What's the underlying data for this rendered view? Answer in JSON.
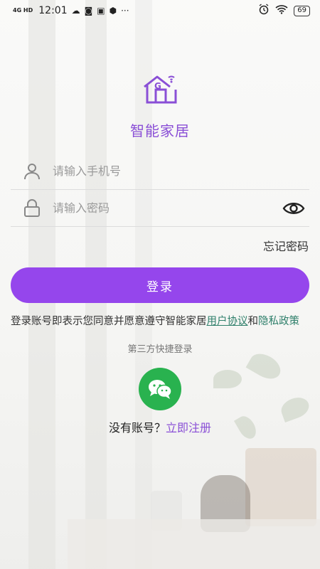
{
  "status_bar": {
    "network": "4G HD",
    "time": "12:01",
    "icons": [
      "cloud-icon",
      "cat-icon",
      "n-icon",
      "shield-icon",
      "more-icon"
    ],
    "right_icons": [
      "alarm-icon",
      "wifi-icon"
    ],
    "battery": "69"
  },
  "app": {
    "logo": "smart-home-logo",
    "title": "智能家居"
  },
  "login": {
    "phone_placeholder": "请输入手机号",
    "password_placeholder": "请输入密码",
    "forgot_password": "忘记密码",
    "login_button": "登录"
  },
  "agreement": {
    "prefix": "登录账号即表示您同意并愿意遵守智能家居",
    "user_agreement": "用户协议",
    "and": "和",
    "privacy_policy": "隐私政策"
  },
  "third_party": {
    "title": "第三方快捷登录",
    "wechat_icon": "wechat-icon"
  },
  "register": {
    "prompt": "没有账号？",
    "link": "立即注册"
  },
  "colors": {
    "accent": "#9546ec",
    "title_purple": "#8a4fd6",
    "link_green": "#2e7f6a",
    "wechat_green": "#29b24f"
  }
}
